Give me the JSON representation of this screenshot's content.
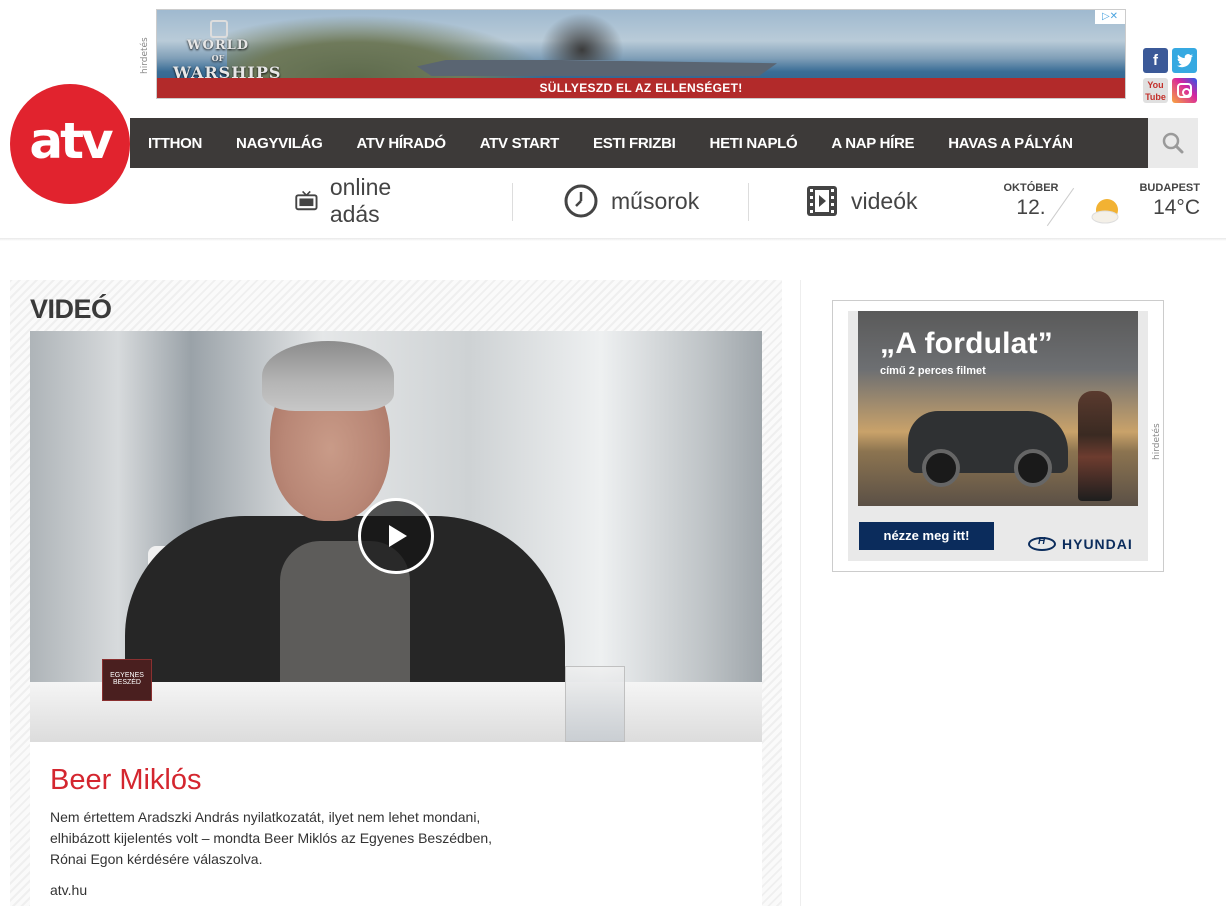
{
  "top_ad": {
    "label": "hirdetés",
    "logo_line1": "WORLD",
    "logo_line2": "OF",
    "logo_line3": "WARSHIPS",
    "tagline": "SÜLLYESZD EL AZ ELLENSÉGET!",
    "adchoices": "▷✕"
  },
  "social": {
    "facebook": "f",
    "twitter": "t",
    "youtube": "You Tube",
    "instagram_icon": "instagram-icon"
  },
  "logo": {
    "text": "atv",
    "color": "#e1232e"
  },
  "nav": {
    "items": [
      "ITTHON",
      "NAGYVILÁG",
      "ATV HÍRADÓ",
      "ATV START",
      "ESTI FRIZBI",
      "HETI NAPLÓ",
      "A NAP HÍRE",
      "HAVAS A PÁLYÁN"
    ],
    "search_icon": "search-icon"
  },
  "subnav": {
    "online": "online adás",
    "shows": "műsorok",
    "videos": "videók"
  },
  "date": {
    "month": "OKTÓBER",
    "day": "12."
  },
  "weather": {
    "city": "BUDAPEST",
    "temp": "14°C",
    "icon": "sun-cloud-icon"
  },
  "video_section": {
    "heading": "VIDEÓ",
    "player_tag": "EGYENES BESZÉD",
    "title": "Beer Miklós",
    "description": "Nem értettem Aradszki András nyilatkozatát, ilyet nem lehet mondani, elhibázott kijelentés volt – mondta Beer Miklós az Egyenes Beszédben, Rónai Egon kérdésére válaszolva.",
    "source": "atv.hu"
  },
  "side_ad": {
    "label": "hirdetés",
    "headline": "„A fordulat”",
    "sub": "című 2 perces filmet",
    "cta": "nézze meg itt!",
    "brand": "HYUNDAI"
  },
  "colors": {
    "brand_red": "#e1232e",
    "nav_bg": "#3d3a39",
    "title_red": "#d4262f"
  }
}
